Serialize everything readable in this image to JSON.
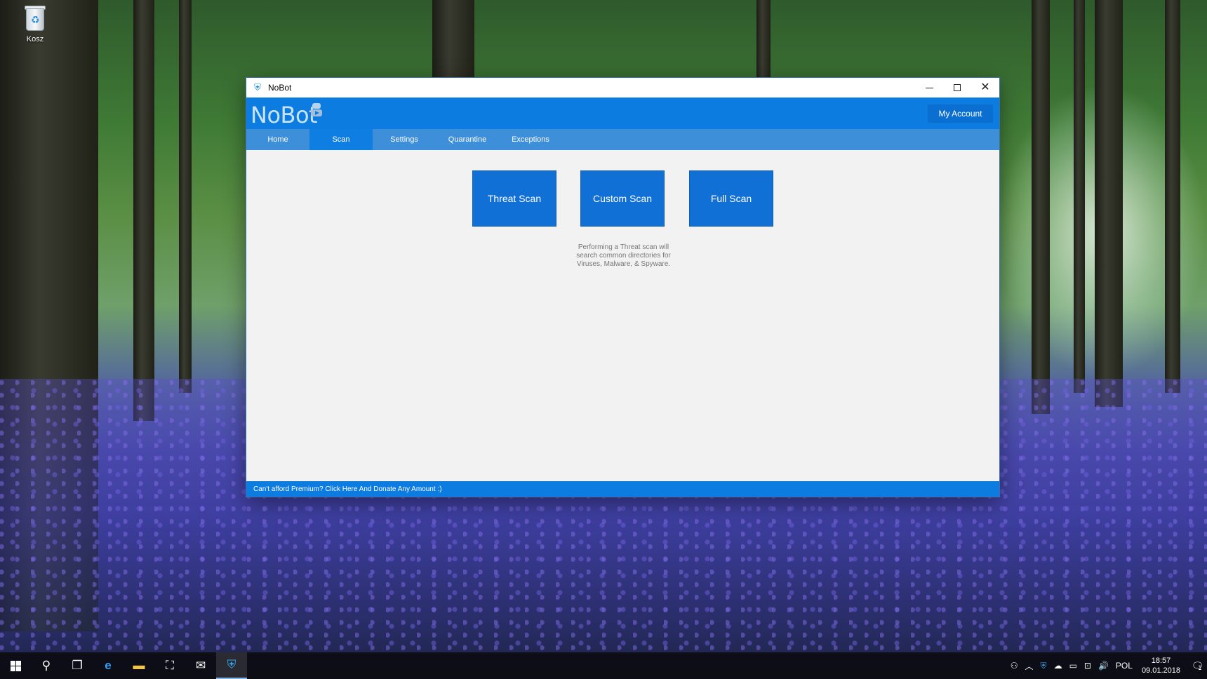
{
  "desktop": {
    "recycle_bin_label": "Kosz"
  },
  "window": {
    "title": "NoBot",
    "controls": {
      "minimize": "minimize",
      "maximize": "maximize",
      "close": "✕"
    }
  },
  "header": {
    "logo_text": "NoBot",
    "account_button": "My Account"
  },
  "tabs": [
    {
      "label": "Home"
    },
    {
      "label": "Scan",
      "active": true
    },
    {
      "label": "Settings"
    },
    {
      "label": "Quarantine"
    },
    {
      "label": "Exceptions"
    }
  ],
  "scan": {
    "threat_label": "Threat Scan",
    "custom_label": "Custom Scan",
    "full_label": "Full Scan",
    "description_line1": "Performing a Threat scan will",
    "description_line2": "search common directories for",
    "description_line3": "Viruses, Malware, & Spyware."
  },
  "footer": {
    "donate_text": "Can't afford Premium? Click Here And Donate Any Amount :)"
  },
  "taskbar": {
    "language": "POL",
    "time": "18:57",
    "date": "09.01.2018",
    "notification_count": "1"
  },
  "colors": {
    "accent": "#0c7ce0",
    "tab_bar": "#3c8fd8",
    "scan_button": "#1170d6"
  }
}
